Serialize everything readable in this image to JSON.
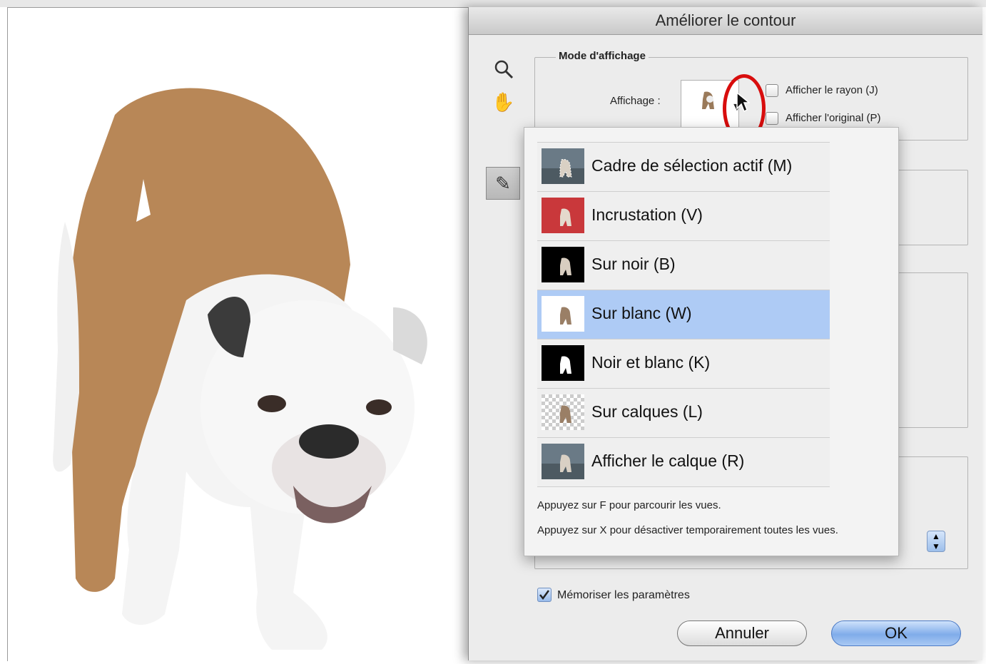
{
  "dialog": {
    "title": "Améliorer le contour",
    "display_mode_group": "Mode d'affichage",
    "display_label": "Affichage :",
    "show_radius_label": "Afficher le rayon (J)",
    "show_original_label": "Afficher l'original (P)",
    "remember_label": "Mémoriser les paramètres",
    "remember_checked": true,
    "cancel_label": "Annuler",
    "ok_label": "OK"
  },
  "view_menu": {
    "items": [
      {
        "label": "Cadre de sélection actif (M)",
        "thumb": "marching-ants-thumb"
      },
      {
        "label": "Incrustation (V)",
        "thumb": "red-overlay-thumb"
      },
      {
        "label": "Sur noir (B)",
        "thumb": "on-black-thumb"
      },
      {
        "label": "Sur blanc (W)",
        "thumb": "on-white-thumb"
      },
      {
        "label": "Noir et blanc (K)",
        "thumb": "mask-thumb"
      },
      {
        "label": "Sur calques (L)",
        "thumb": "transparency-thumb"
      },
      {
        "label": "Afficher le calque (R)",
        "thumb": "layer-thumb"
      }
    ],
    "selected_index": 3,
    "hint_cycle": "Appuyez sur F pour parcourir les vues.",
    "hint_disable": "Appuyez sur X pour désactiver temporairement toutes les vues."
  },
  "colors": {
    "selection": "#aecbf5",
    "highlight_ring": "#d80d0d",
    "ok_button": "#80acea"
  },
  "icons": [
    "zoom-icon",
    "hand-icon",
    "refine-brush-icon",
    "dropdown-arrow-icon",
    "cursor-icon"
  ]
}
